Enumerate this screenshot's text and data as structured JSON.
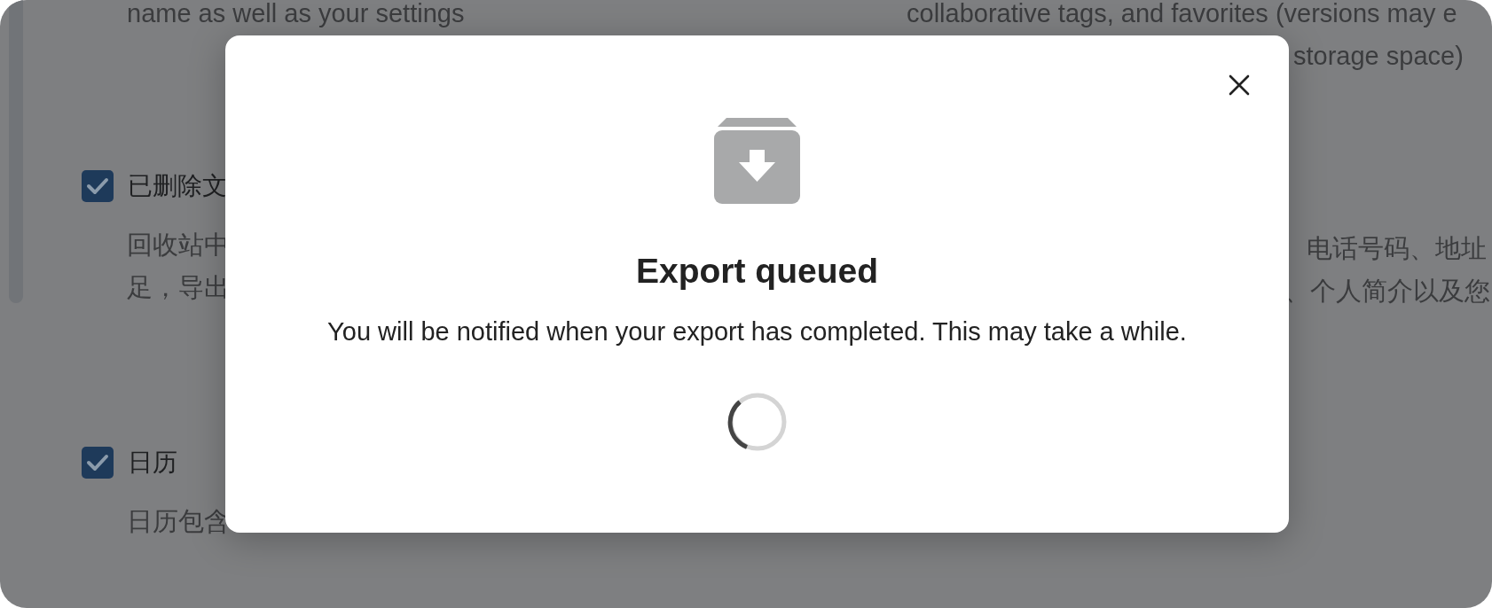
{
  "background": {
    "left_column": [
      {
        "kind": "text",
        "text": "name as well as your settings"
      },
      {
        "kind": "checkbox",
        "label": "已删除文",
        "checked": true
      },
      {
        "kind": "text",
        "text": "回收站中"
      },
      {
        "kind": "text",
        "text": "足，导出"
      },
      {
        "kind": "checkbox",
        "label": "日历",
        "checked": true
      },
      {
        "kind": "text",
        "text": "日历包含"
      }
    ],
    "right_column": [
      {
        "kind": "text",
        "text": "collaborative tags, and favorites (versions may e"
      },
      {
        "kind": "text",
        "text": "storage space)"
      },
      {
        "kind": "text",
        "text": "电话号码、地址"
      },
      {
        "kind": "text",
        "text": "、个人简介以及您"
      }
    ]
  },
  "dialog": {
    "title": "Export queued",
    "message": "You will be notified when your export has completed. This may take a while."
  }
}
